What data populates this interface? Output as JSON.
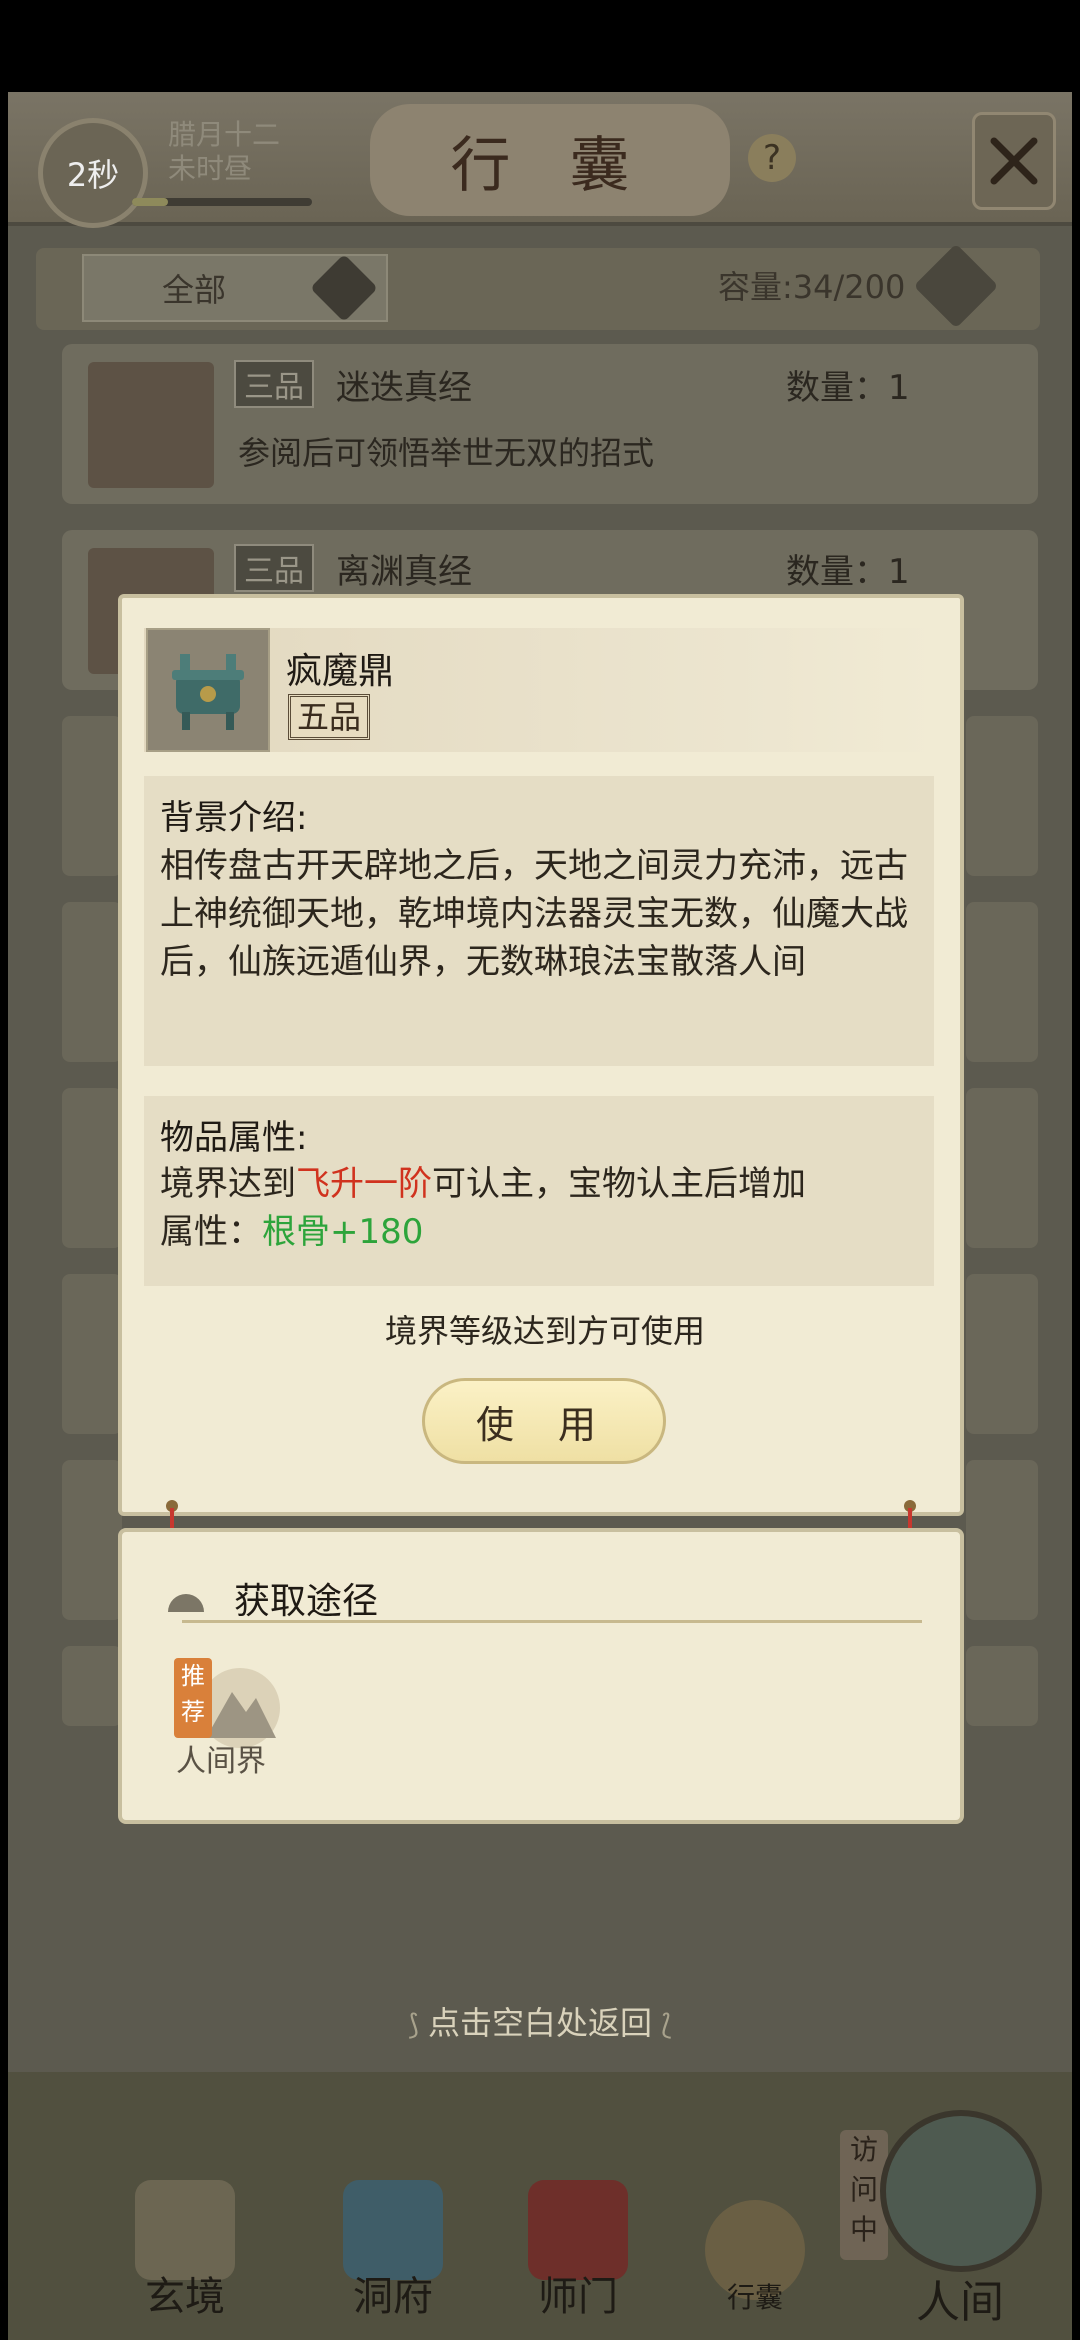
{
  "header": {
    "timer": "2秒",
    "date_line1": "腊月十二",
    "date_line2": "未时昼",
    "title": "行 囊",
    "help": "?",
    "close_icon": "close-x-icon"
  },
  "filter": {
    "selected": "全部",
    "capacity": "容量:34/200"
  },
  "inventory": [
    {
      "grade": "三品",
      "name": "迷迭真经",
      "qty": "数量：1",
      "desc": "参阅后可领悟举世无双的招式"
    },
    {
      "grade": "三品",
      "name": "离渊真经",
      "qty": "数量：1",
      "desc": ""
    }
  ],
  "popup": {
    "item_name": "疯魔鼎",
    "item_grade": "五品",
    "bg_title": "背景介绍:",
    "bg_text": "相传盘古开天辟地之后，天地之间灵力充沛，远古上神统御天地，乾坤境内法器灵宝无数，仙魔大战后，仙族远遁仙界，无数琳琅法宝散落人间",
    "attr_title": "物品属性:",
    "attr_prefix": "境界达到",
    "attr_realm": "飞升一阶",
    "attr_suffix": "可认主，宝物认主后增加",
    "attr_label": "属性：",
    "attr_value": "根骨+180",
    "requirement": "境界等级达到方可使用",
    "use_button": "使 用"
  },
  "source": {
    "title": "获取途径",
    "badge": "推荐",
    "world": "人间界"
  },
  "hint": "点击空白处返回",
  "nav": {
    "items": [
      {
        "label": "玄境"
      },
      {
        "label": "洞府"
      },
      {
        "label": "师门"
      },
      {
        "label": "行囊"
      },
      {
        "label": "人间"
      }
    ],
    "visiting": "访问中"
  }
}
